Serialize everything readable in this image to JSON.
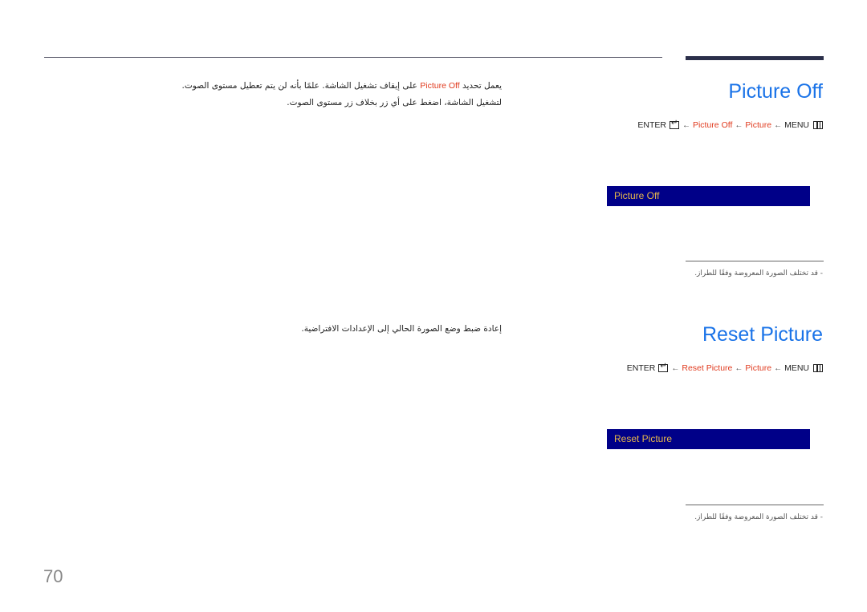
{
  "page_number": "70",
  "sections": [
    {
      "title": "Picture Off",
      "path": {
        "enter_label": "ENTER",
        "item": "Picture Off",
        "menu": "Picture",
        "menu_label": "MENU",
        "arrow": "←"
      },
      "osd_label": "Picture Off",
      "note": "-  قد تختلف الصورة المعروضة وفقًا للطراز.",
      "description": {
        "line1_before": "يعمل تحديد ",
        "line1_highlight": "Picture Off",
        "line1_after": " على إيقاف تشغيل الشاشة. علمًا بأنه لن يتم تعطيل مستوى الصوت.",
        "line2": "لتشغيل الشاشة، اضغط على أي زر بخلاف زر مستوى الصوت."
      }
    },
    {
      "title": "Reset Picture",
      "path": {
        "enter_label": "ENTER",
        "item": "Reset Picture",
        "menu": "Picture",
        "menu_label": "MENU",
        "arrow": "←"
      },
      "osd_label": "Reset Picture",
      "note": "-  قد تختلف الصورة المعروضة وفقًا للطراز.",
      "description": {
        "line1": "إعادة ضبط وضع الصورة الحالي إلى الإعدادات الافتراضية."
      }
    }
  ],
  "colors": {
    "title": "#1a73e8",
    "highlight": "#e03a1e",
    "osd_background": "#000088",
    "osd_text": "#e8b84a"
  }
}
